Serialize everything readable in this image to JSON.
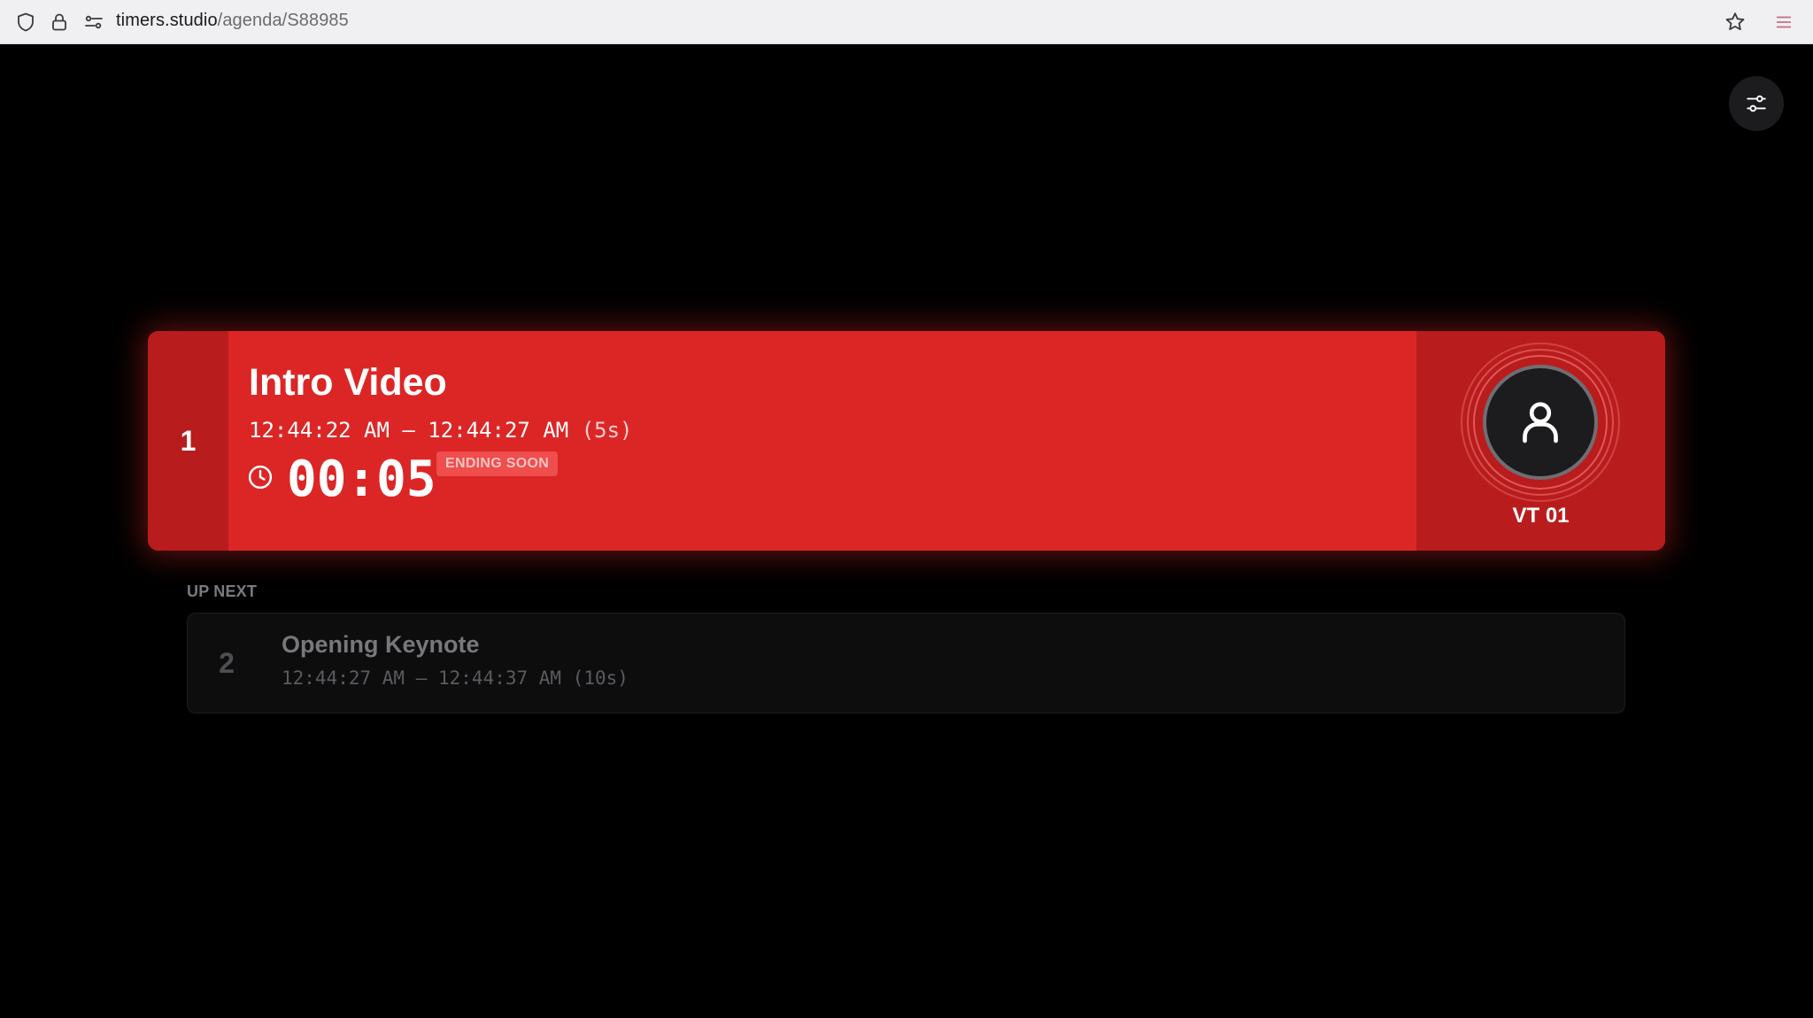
{
  "browser": {
    "url_host": "timers.studio",
    "url_path": "/agenda/S88985",
    "icons": [
      "shield-icon",
      "lock-icon",
      "site-settings-icon",
      "star-icon",
      "menu-icon"
    ]
  },
  "page": {
    "settings_icon": "sliders-icon",
    "current": {
      "index": "1",
      "title": "Intro Video",
      "time_range": "12:44:22 AM – 12:44:27 AM",
      "duration": "(5s)",
      "countdown": "00:05",
      "status": "ENDING SOON",
      "presenter": "VT 01",
      "accent_color": "#dc2626"
    },
    "up_next": {
      "label": "UP NEXT",
      "items": [
        {
          "index": "2",
          "title": "Opening Keynote",
          "time_range": "12:44:27 AM – 12:44:37 AM",
          "duration": "(10s)"
        }
      ]
    }
  }
}
